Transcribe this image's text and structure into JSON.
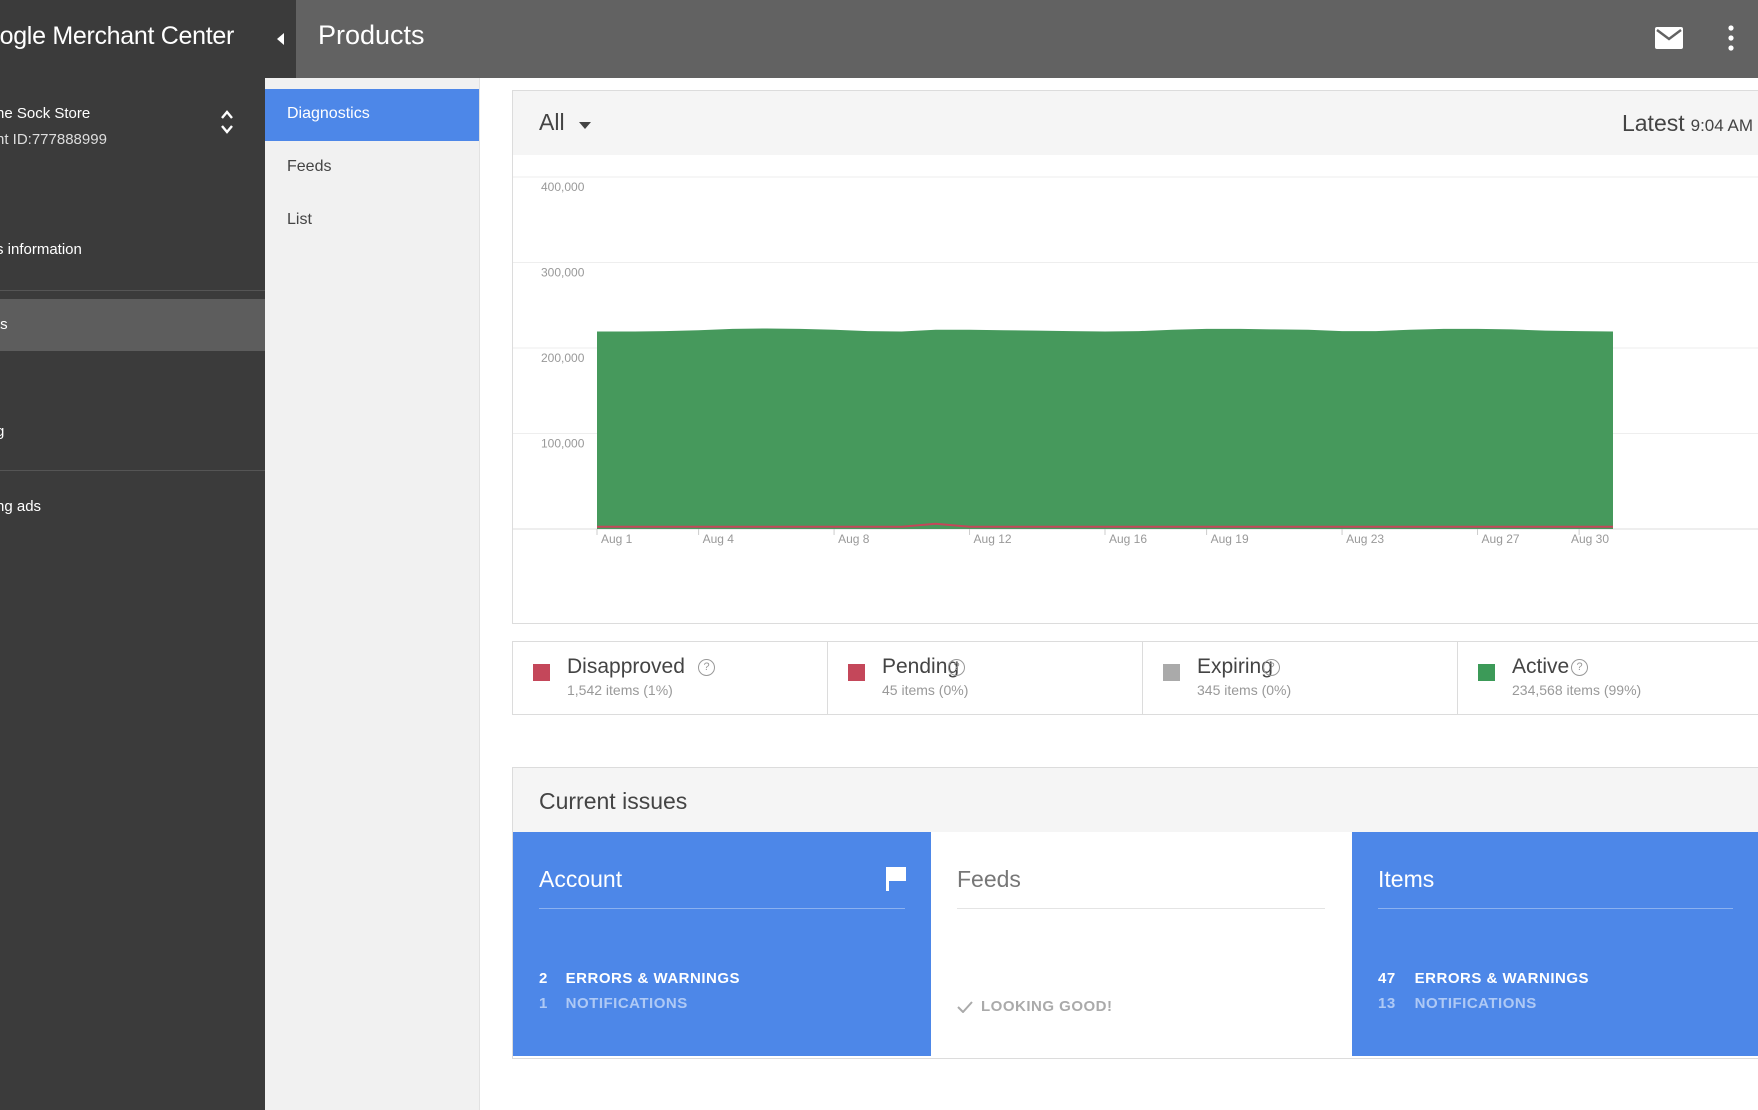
{
  "header": {
    "brand": "oogle Merchant Center",
    "page_title": "Products"
  },
  "sidebar": {
    "account_name": "ne Sock Store",
    "account_id": "nt ID:777888999",
    "items": [
      {
        "label": "s information"
      },
      {
        "label": "ts",
        "active": true
      },
      {
        "label": "g"
      },
      {
        "label": "ng ads"
      }
    ]
  },
  "subnav": {
    "items": [
      {
        "label": "Diagnostics",
        "active": true
      },
      {
        "label": "Feeds"
      },
      {
        "label": "List"
      }
    ]
  },
  "chart_header": {
    "filter": "All",
    "latest_label": "Latest",
    "latest_time": "9:04 AM"
  },
  "chart_data": {
    "type": "area",
    "title": "",
    "xlabel": "",
    "ylabel": "",
    "ylim": [
      0,
      400000
    ],
    "yticks": [
      "400,000",
      "300,000",
      "200,000",
      "100,000"
    ],
    "xticks": [
      "Aug 1",
      "Aug 4",
      "Aug 8",
      "Aug 12",
      "Aug 16",
      "Aug 19",
      "Aug 23",
      "Aug 27",
      "Aug 30"
    ],
    "grid": true,
    "x": [
      1,
      2,
      3,
      4,
      5,
      6,
      7,
      8,
      9,
      10,
      11,
      12,
      13,
      14,
      15,
      16,
      17,
      18,
      19,
      20,
      21,
      22,
      23,
      24,
      25,
      26,
      27,
      28,
      29,
      30,
      31
    ],
    "series": [
      {
        "name": "Active",
        "color": "#46995c",
        "values": [
          231000,
          231000,
          231500,
          232500,
          234000,
          234500,
          234000,
          233000,
          231500,
          231000,
          233000,
          233000,
          232500,
          232000,
          231500,
          231000,
          231500,
          233000,
          234000,
          234000,
          233500,
          233000,
          231500,
          231500,
          233000,
          234000,
          234000,
          233500,
          232000,
          231500,
          231000
        ]
      },
      {
        "name": "Disapproved",
        "color": "#c4475a",
        "values": [
          1500,
          1500,
          1500,
          1500,
          1500,
          1500,
          1500,
          1500,
          1500,
          1500,
          5000,
          1500,
          1500,
          1500,
          1500,
          1500,
          1500,
          1500,
          1500,
          1500,
          1500,
          1500,
          1500,
          1500,
          1500,
          1500,
          1500,
          1500,
          1500,
          1500,
          1500
        ]
      }
    ]
  },
  "legend": [
    {
      "name": "Disapproved",
      "sub": "1,542 items (1%)",
      "color": "#c4475a"
    },
    {
      "name": "Pending",
      "sub": "45 items (0%)",
      "color": "#c4475a"
    },
    {
      "name": "Expiring",
      "sub": "345 items (0%)",
      "color": "#aaaaaa"
    },
    {
      "name": "Active",
      "sub": "234,568 items (99%)",
      "color": "#3c9a58"
    }
  ],
  "issues": {
    "title": "Current issues",
    "cards": [
      {
        "title": "Account",
        "count1": "2",
        "label1": "ERRORS & WARNINGS",
        "count2": "1",
        "label2": "NOTIFICATIONS"
      },
      {
        "title": "Feeds",
        "status": "LOOKING GOOD!"
      },
      {
        "title": "Items",
        "count1": "47",
        "label1": "ERRORS & WARNINGS",
        "count2": "13",
        "label2": "NOTIFICATIONS"
      }
    ]
  },
  "colors": {
    "accent": "#4d87e8",
    "topbar": "#626262",
    "sidebar": "#3b3b3b",
    "active_area": "#46995c"
  },
  "icons": [
    "chevron-left-icon",
    "mail-icon",
    "more-vert-icon",
    "unfold-icon",
    "dropdown-arrow-icon",
    "help-icon",
    "flag-icon",
    "check-icon"
  ]
}
